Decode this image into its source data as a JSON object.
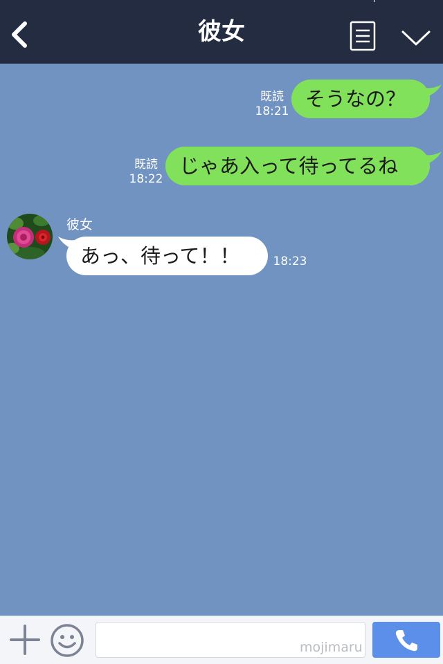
{
  "header": {
    "title": "彼女",
    "back_icon": "chevron-left-icon",
    "note_icon": "note-icon",
    "menu_icon": "chevron-down-icon",
    "background": "#232c41"
  },
  "chat": {
    "background": "#7093c1",
    "messages": [
      {
        "direction": "outgoing",
        "read_label": "既読",
        "time": "18:21",
        "text": "そうなの？"
      },
      {
        "direction": "outgoing",
        "read_label": "既読",
        "time": "18:22",
        "text": "じゃあ入って待ってるね"
      },
      {
        "direction": "incoming",
        "sender": "彼女",
        "avatar_icon": "rose-avatar-icon",
        "time": "18:23",
        "text": "あっ、待って！！"
      }
    ]
  },
  "footer": {
    "plus_icon": "plus-icon",
    "emoji_icon": "smiley-icon",
    "input_value": "",
    "input_placeholder": "",
    "watermark": "mojimaru",
    "call_icon": "phone-icon",
    "call_button_color": "#5b8fe9"
  },
  "colors": {
    "outgoing_bubble": "#82e15a",
    "incoming_bubble": "#ffffff",
    "meta_text": "#ffffff"
  }
}
